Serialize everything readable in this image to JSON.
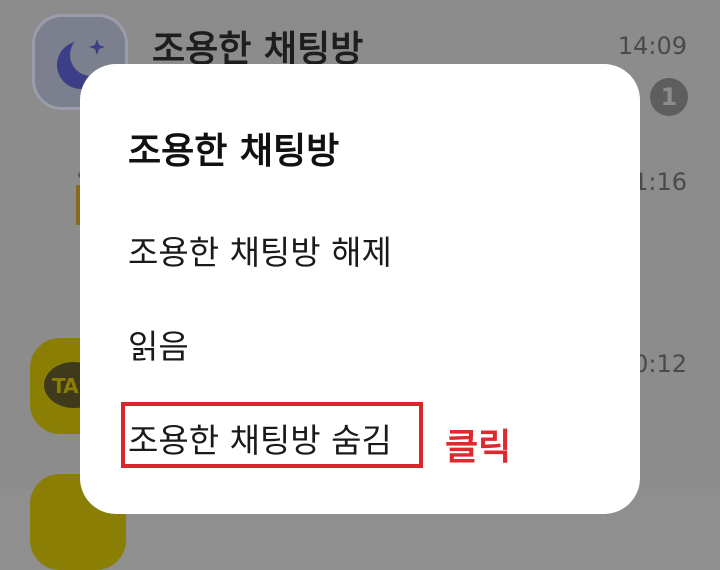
{
  "background_list": {
    "rows": [
      {
        "title": "조용한 채팅방",
        "time": "14:09",
        "unread": "1"
      },
      {
        "time": "1:16"
      },
      {
        "avatar_text": "TA",
        "time": "0:12"
      }
    ]
  },
  "dialog": {
    "title": "조용한 채팅방",
    "items": [
      {
        "label": "조용한 채팅방 해제"
      },
      {
        "label": "읽음"
      },
      {
        "label": "조용한 채팅방 숨김"
      }
    ]
  },
  "annotation": {
    "label": "클릭",
    "color": "#d8262b"
  },
  "colors": {
    "dim_overlay": "#8c8c8c",
    "dialog_bg": "#ffffff",
    "kakao_yellow_dimmed": "#8a7f04"
  },
  "icons": [
    "moon-icon",
    "kakao-talk-icon"
  ]
}
